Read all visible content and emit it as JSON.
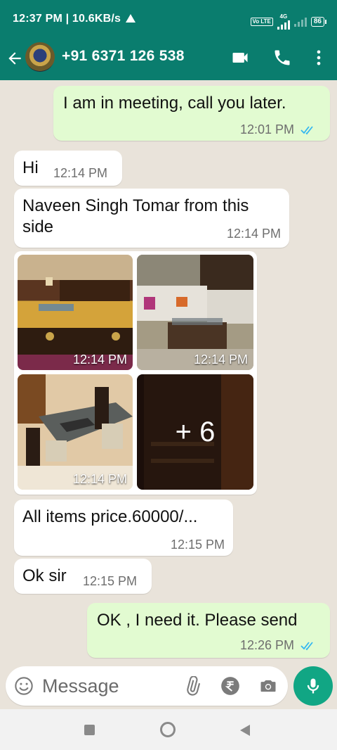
{
  "status_bar": {
    "left_text": "12:37 PM | 10.6KB/s",
    "volte": "Vo LTE",
    "network": "4G",
    "battery": "86"
  },
  "header": {
    "contact": "+91 6371 126 538",
    "avatar_icon": "avatar-emblem",
    "icons": [
      "back-arrow-icon",
      "video-call-icon",
      "phone-icon",
      "more-vert-icon"
    ]
  },
  "messages": [
    {
      "dir": "out",
      "text": "I am in meeting, call you later.",
      "time": "12:01 PM",
      "read": true
    },
    {
      "dir": "in",
      "text": "Hi",
      "time": "12:14 PM"
    },
    {
      "dir": "in",
      "text_line1": "Naveen Singh Tomar from this",
      "text_line2": "side",
      "time": "12:14 PM"
    },
    {
      "dir": "in",
      "type": "album",
      "photos": [
        {
          "desc": "bed",
          "time": "12:14 PM"
        },
        {
          "desc": "sofa",
          "time": "12:14 PM"
        },
        {
          "desc": "dining-table",
          "time": "12:14 PM"
        },
        {
          "desc": "wardrobe",
          "overlay": "+ 6"
        }
      ]
    },
    {
      "dir": "in",
      "text": "All items price.60000/...",
      "time": "12:15 PM"
    },
    {
      "dir": "in",
      "text": "Ok sir",
      "time": "12:15 PM"
    },
    {
      "dir": "out",
      "text": "OK , I need it. Please send",
      "time": "12:26 PM",
      "read": true
    }
  ],
  "input": {
    "placeholder": "Message",
    "icons": [
      "emoji-icon",
      "attach-icon",
      "rupee-payment-icon",
      "camera-icon",
      "mic-icon"
    ]
  },
  "colors": {
    "header": "#0a7d6e",
    "outgoing_bubble": "#e2fbd1",
    "incoming_bubble": "#ffffff",
    "chat_bg": "#e9e3da",
    "read_tick": "#34b7f1",
    "mic_button": "#11a684"
  }
}
